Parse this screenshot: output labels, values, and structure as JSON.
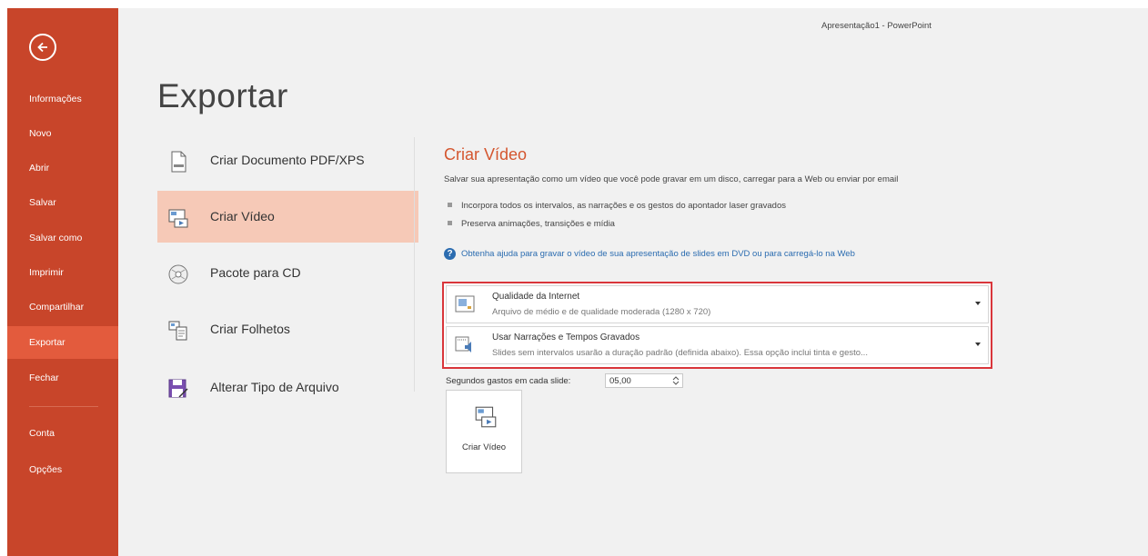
{
  "window": {
    "title": "Apresentação1 - PowerPoint"
  },
  "sidebar": {
    "items": [
      {
        "label": "Informações"
      },
      {
        "label": "Novo"
      },
      {
        "label": "Abrir"
      },
      {
        "label": "Salvar"
      },
      {
        "label": "Salvar como"
      },
      {
        "label": "Imprimir"
      },
      {
        "label": "Compartilhar"
      },
      {
        "label": "Exportar",
        "active": true
      },
      {
        "label": "Fechar"
      },
      {
        "label": "Conta"
      },
      {
        "label": "Opções"
      }
    ],
    "background": "#c8452a",
    "active_color": "#e35b3d"
  },
  "main": {
    "title": "Exportar",
    "options": [
      {
        "label": "Criar Documento PDF/XPS",
        "icon": "pdf-document-icon"
      },
      {
        "label": "Criar Vídeo",
        "icon": "video-icon",
        "selected": true
      },
      {
        "label": "Pacote para CD",
        "icon": "cd-icon"
      },
      {
        "label": "Criar Folhetos",
        "icon": "handouts-icon"
      },
      {
        "label": "Alterar Tipo de Arquivo",
        "icon": "save-as-icon"
      }
    ]
  },
  "detail": {
    "title": "Criar Vídeo",
    "description": "Salvar sua apresentação como um vídeo que você pode gravar em um disco, carregar para a Web ou enviar por email",
    "bullets": [
      "Incorpora todos os intervalos, as narrações e os gestos do apontador laser gravados",
      "Preserva animações, transições e mídia"
    ],
    "help_link": "Obtenha ajuda para gravar o vídeo de sua apresentação de slides em DVD ou para carregá-lo na Web",
    "quality_dropdown": {
      "title": "Qualidade da Internet",
      "subtitle": "Arquivo de médio e de qualidade moderada (1280 x 720)"
    },
    "timings_dropdown": {
      "title": "Usar Narrações e Tempos Gravados",
      "subtitle": "Slides sem intervalos usarão a duração padrão (definida abaixo). Essa opção inclui tinta e gesto..."
    },
    "seconds_label": "Segundos gastos em cada slide:",
    "seconds_value": "05,00",
    "create_button": "Criar Vídeo",
    "accent": "#d4562f",
    "highlight_border": "#d9363b"
  }
}
